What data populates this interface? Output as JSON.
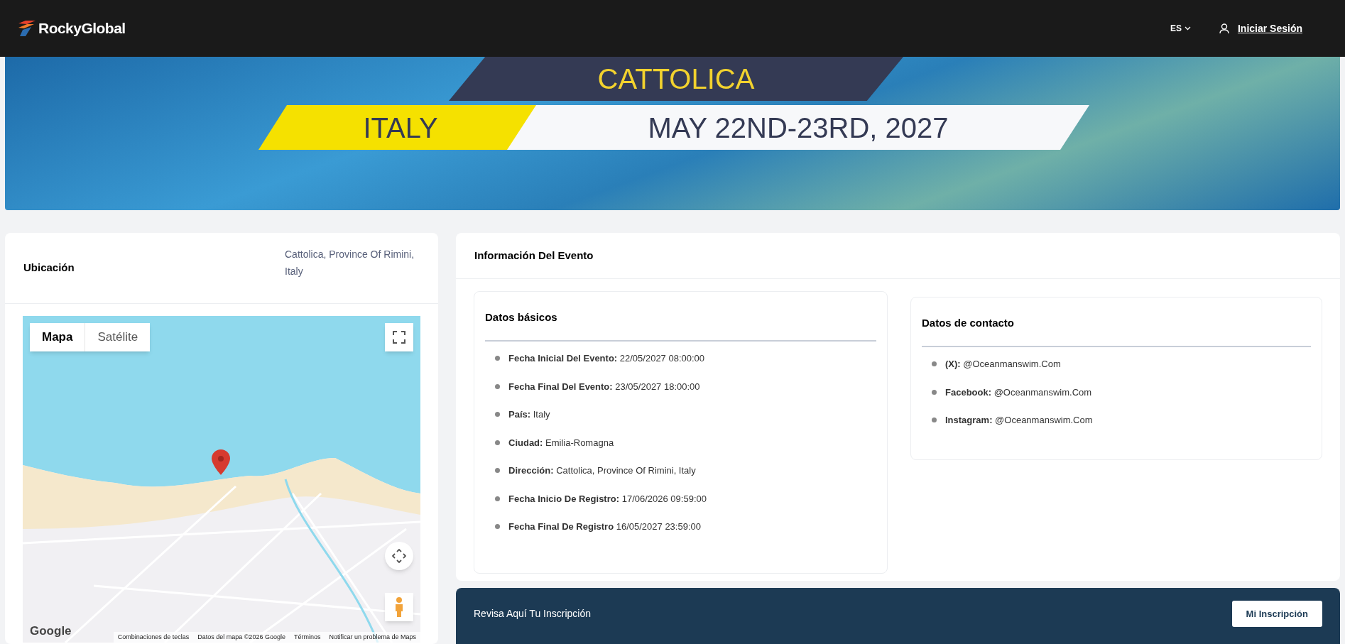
{
  "header": {
    "logo": "RockyGlobal",
    "language": "ES",
    "login": "Iniciar Sesión"
  },
  "banner": {
    "city": "CATTOLICA",
    "country": "ITALY",
    "dates": "MAY 22ND-23RD, 2027"
  },
  "location": {
    "title": "Ubicación",
    "address": "Cattolica, Province Of Rimini, Italy",
    "map": {
      "tabs": [
        {
          "label": "Mapa",
          "selected": true
        },
        {
          "label": "Satélite",
          "selected": false
        }
      ],
      "logo": "Google",
      "attribution": [
        "Combinaciones de teclas",
        "Datos del mapa ©2026 Google",
        "Términos",
        "Notificar un problema de Maps"
      ]
    }
  },
  "event_info": {
    "title": "Información Del Evento",
    "basic": {
      "title": "Datos básicos",
      "items": [
        {
          "label": "Fecha Inicial Del Evento:",
          "value": "22/05/2027 08:00:00"
        },
        {
          "label": "Fecha Final Del Evento:",
          "value": "23/05/2027 18:00:00"
        },
        {
          "label": "País:",
          "value": "Italy"
        },
        {
          "label": "Ciudad:",
          "value": "Emilia-Romagna"
        },
        {
          "label": "Dirección:",
          "value": "Cattolica, Province Of Rimini, Italy"
        },
        {
          "label": "Fecha Inicio De Registro:",
          "value": "17/06/2026 09:59:00"
        },
        {
          "label": "Fecha Final De Registro",
          "value": "16/05/2027 23:59:00"
        }
      ]
    },
    "contact": {
      "title": "Datos de contacto",
      "items": [
        {
          "label": "(X):",
          "value": "@Oceanmanswim.Com"
        },
        {
          "label": "Facebook:",
          "value": "@Oceanmanswim.Com"
        },
        {
          "label": "Instagram:",
          "value": "@Oceanmanswim.Com"
        }
      ]
    }
  },
  "registration": {
    "text": "Revisa Aquí Tu Inscripción",
    "button": "Mi Inscripción"
  }
}
